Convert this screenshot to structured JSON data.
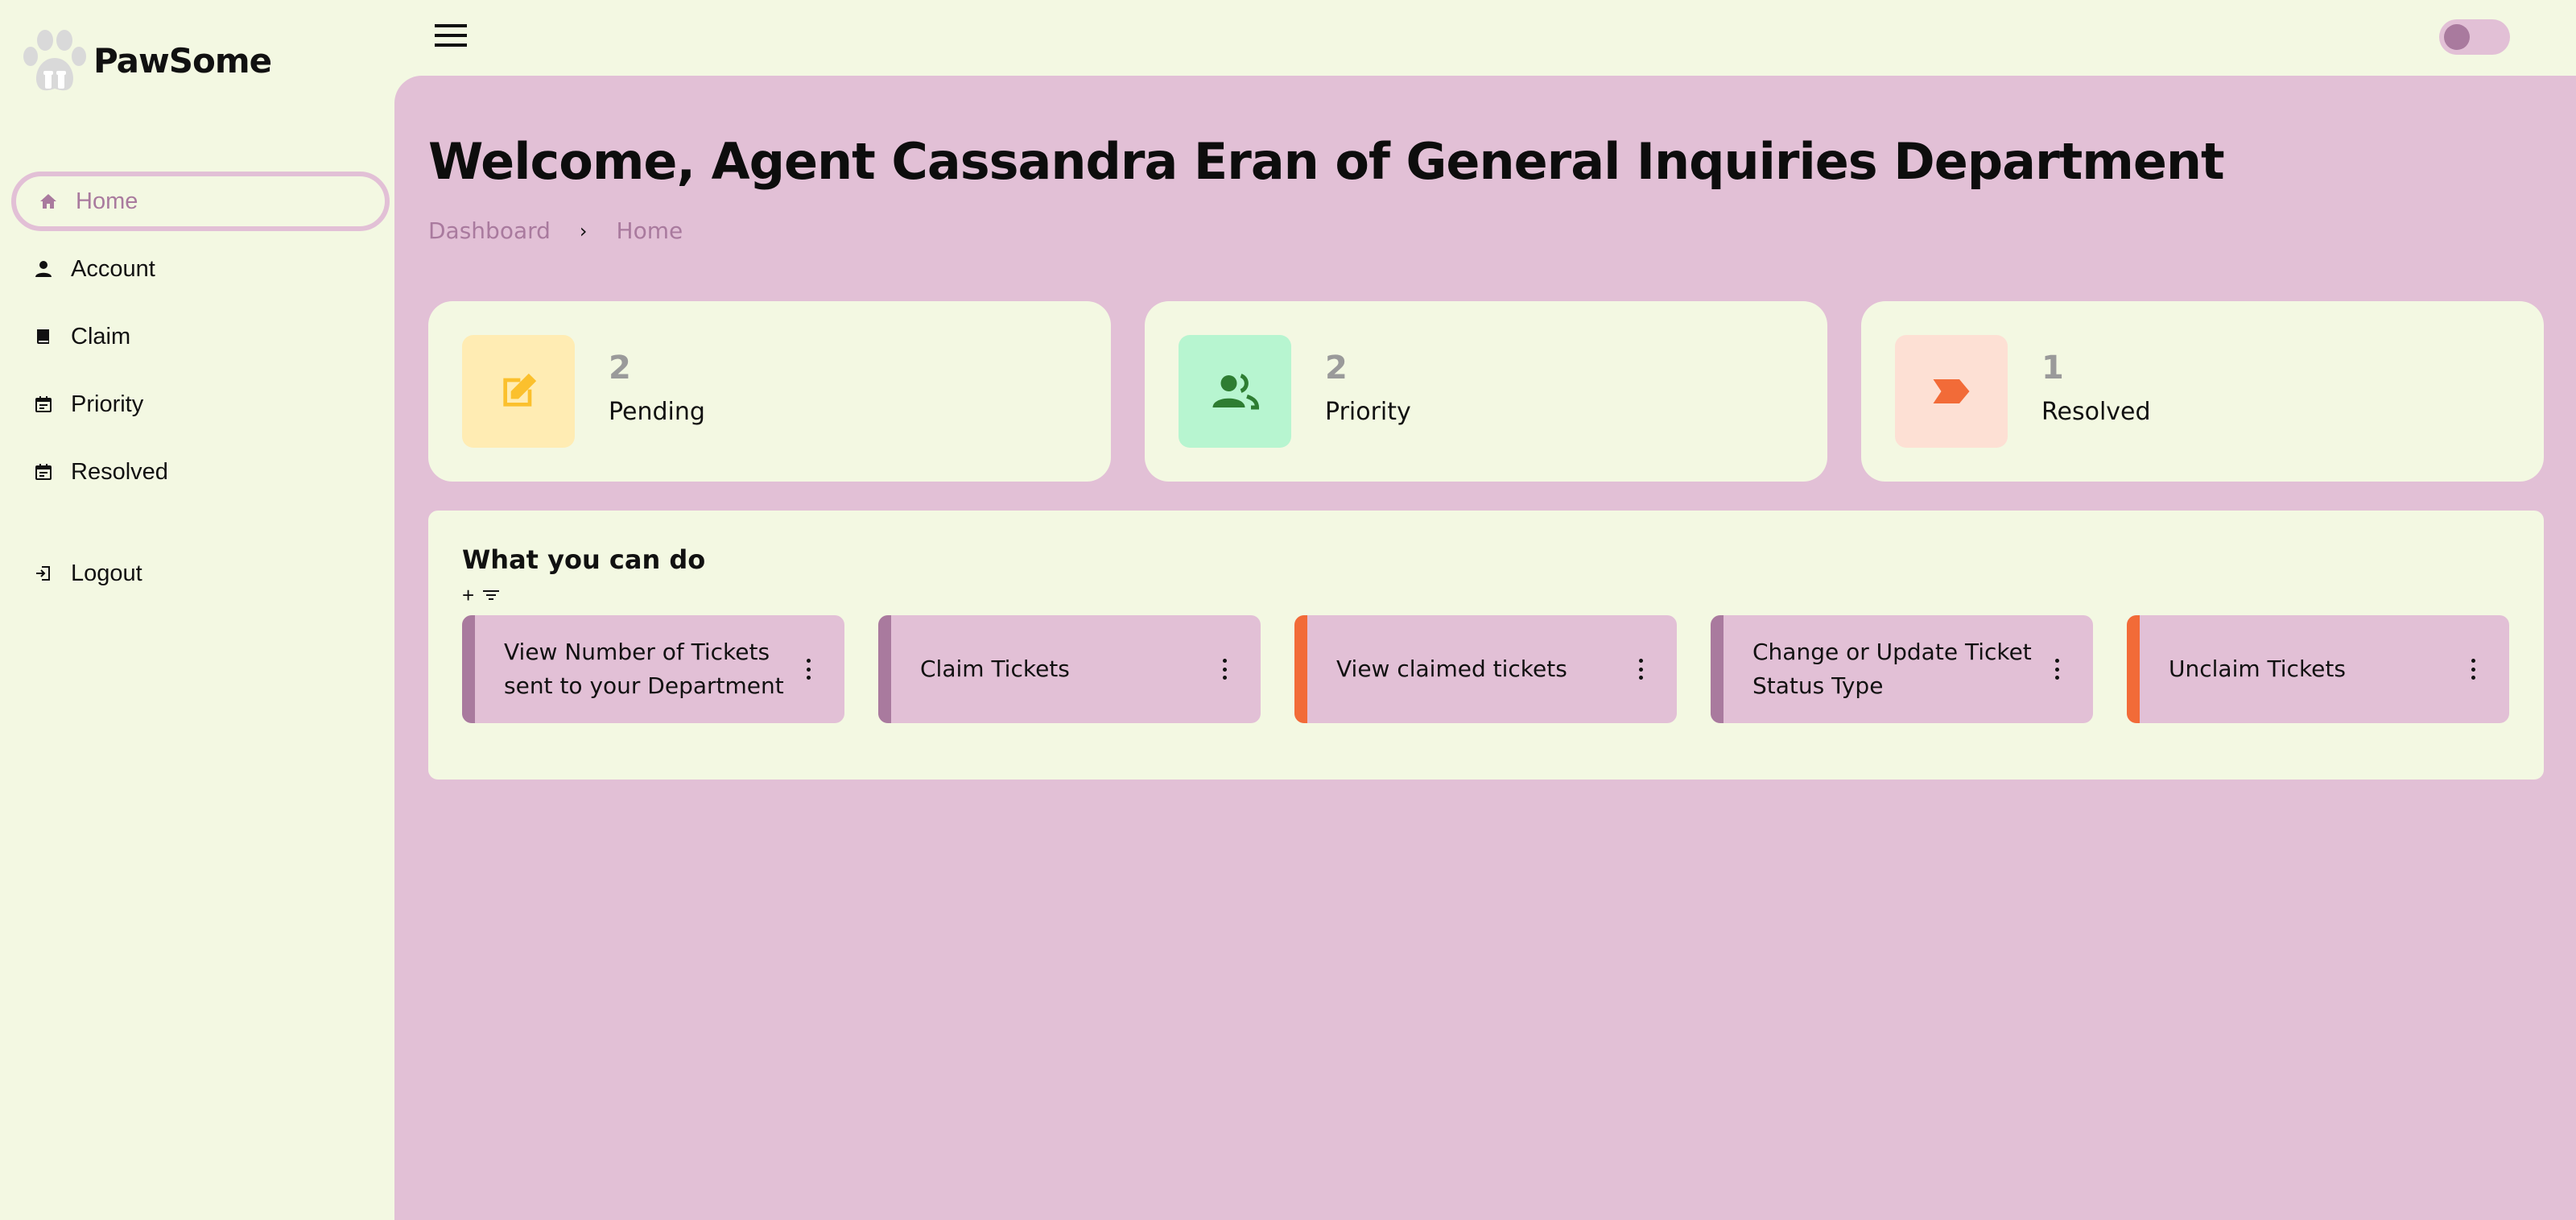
{
  "brand": {
    "name": "PawSome"
  },
  "sidebar": {
    "items": [
      {
        "label": "Home",
        "icon": "home-icon"
      },
      {
        "label": "Account",
        "icon": "person-icon"
      },
      {
        "label": "Claim",
        "icon": "book-icon"
      },
      {
        "label": "Priority",
        "icon": "calendar-icon"
      },
      {
        "label": "Resolved",
        "icon": "calendar-icon"
      }
    ],
    "logout": {
      "label": "Logout",
      "icon": "logout-icon"
    }
  },
  "header": {
    "title": "Welcome, Agent Cassandra Eran of General Inquiries Department",
    "breadcrumb": [
      "Dashboard",
      "Home"
    ],
    "breadcrumb_separator": "›"
  },
  "stats": [
    {
      "count": "2",
      "label": "Pending",
      "tile_color": "#ffecb3",
      "icon_color": "#fbc02d",
      "icon": "edit-note-icon"
    },
    {
      "count": "2",
      "label": "Priority",
      "tile_color": "#b7f5d0",
      "icon_color": "#2e7d32",
      "icon": "people-icon"
    },
    {
      "count": "1",
      "label": "Resolved",
      "tile_color": "#fde0d4",
      "icon_color": "#f26b38",
      "icon": "label-arrow-icon"
    }
  ],
  "actions": {
    "title": "What you can do",
    "tools": {
      "add": "+",
      "filter": "≡"
    },
    "cards": [
      {
        "label": "View Number of Tickets sent to your Department",
        "accent": "#a97a9e"
      },
      {
        "label": "Claim Tickets",
        "accent": "#a97a9e"
      },
      {
        "label": "View claimed tickets",
        "accent": "#f26b38"
      },
      {
        "label": "Change or Update Ticket Status Type",
        "accent": "#a97a9e"
      },
      {
        "label": "Unclaim Tickets",
        "accent": "#f26b38"
      }
    ]
  },
  "colors": {
    "background": "#f3f8e2",
    "main": "#e2c0d6",
    "accent": "#a97a9e",
    "orange": "#f26b38"
  }
}
